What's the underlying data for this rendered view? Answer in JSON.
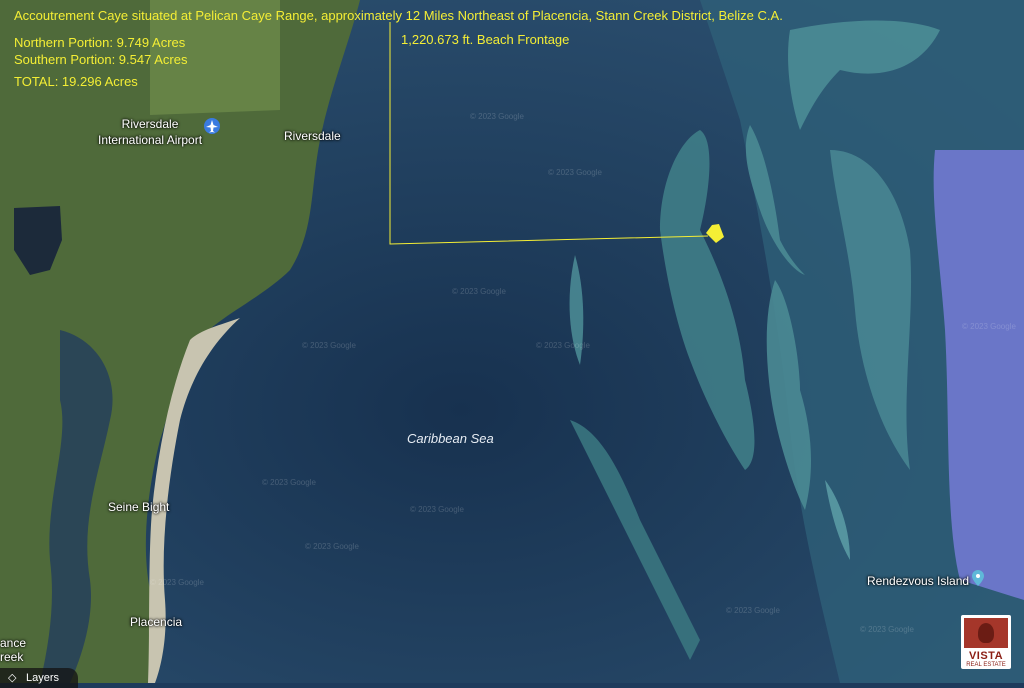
{
  "header": {
    "title": "Accoutrement Caye situated at Pelican Caye Range, approximately 12 Miles Northeast of Placencia, Stann Creek District, Belize C.A.",
    "northern": "Northern Portion:  9.749 Acres",
    "southern": "Southern Portion:  9.547 Acres",
    "total": "TOTAL:  19.296 Acres",
    "frontage": "1,220.673 ft. Beach Frontage"
  },
  "places": {
    "riversdale_airport": "Riversdale\nInternational Airport",
    "riversdale": "Riversdale",
    "sea": "Caribbean Sea",
    "seine_bight": "Seine Bight",
    "placencia": "Placencia",
    "rendezvous": "Rendezvous Island",
    "edge_top": "ance",
    "edge_bottom": "reek"
  },
  "watermark": "© 2023 Google",
  "controls": {
    "layers": "Layers"
  },
  "logo": {
    "name": "VISTA",
    "tagline": "REAL ESTATE"
  },
  "colors": {
    "annotation": "#f4ee35",
    "sea": "#1e3b5c",
    "reef": "#3f7a8a",
    "land": "#4d6a38",
    "pin": "#3a7be0"
  },
  "icons": {
    "airport": "airport-pin-icon",
    "rendezvous": "place-pin-icon",
    "layers": "layers-icon"
  }
}
